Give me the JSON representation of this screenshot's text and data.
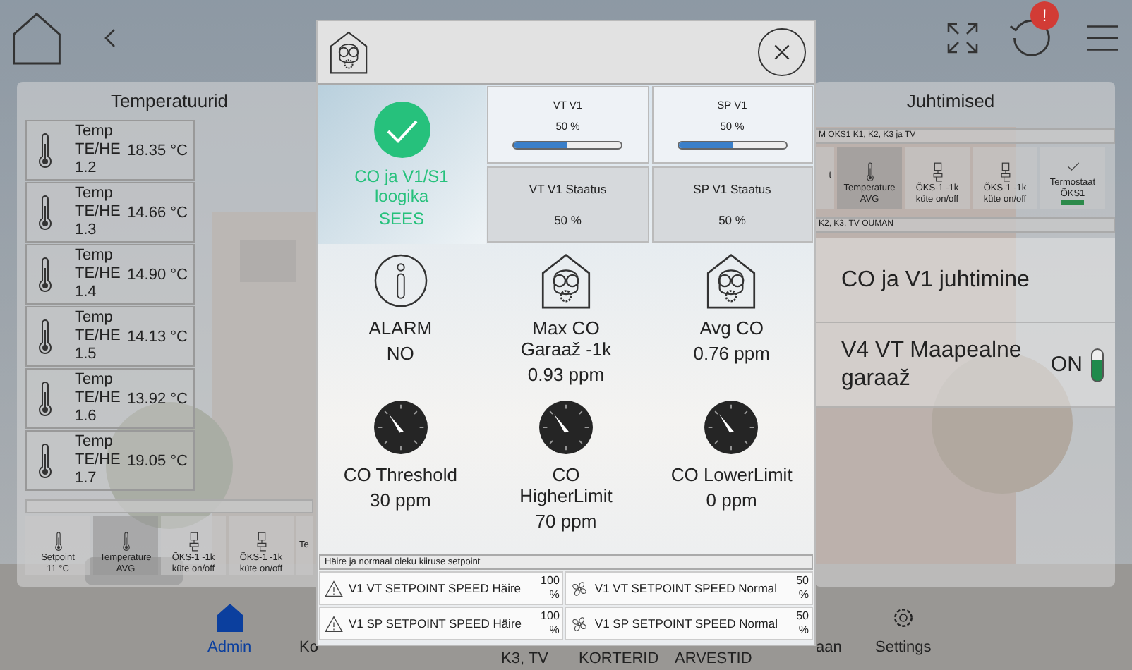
{
  "header": {
    "badge": "!"
  },
  "temperatures": {
    "title": "Temperatuurid",
    "sensors": [
      {
        "label": "Temp TE/HE 1.2",
        "value": "18.35 °C"
      },
      {
        "label": "Temp TE/HE 1.3",
        "value": "14.66 °C"
      },
      {
        "label": "Temp TE/HE 1.4",
        "value": "14.90 °C"
      },
      {
        "label": "Temp TE/HE 1.5",
        "value": "14.13 °C"
      },
      {
        "label": "Temp TE/HE 1.6",
        "value": "13.92 °C"
      },
      {
        "label": "Temp TE/HE 1.7",
        "value": "19.05 °C"
      }
    ],
    "tiles": [
      {
        "kind": "thermometer",
        "name": "Setpoint",
        "value": "11 °C",
        "highlighted": false
      },
      {
        "kind": "thermometer",
        "name": "Temperature AVG",
        "highlighted": true
      },
      {
        "kind": "valve",
        "name": "ÕKS-1 -1k küte on/off",
        "highlighted": false
      },
      {
        "kind": "valve",
        "name": "ÕKS-1 -1k küte on/off",
        "highlighted": false
      },
      {
        "kind": "text",
        "name": "Te",
        "highlighted": false
      }
    ]
  },
  "controls": {
    "title": "Juhtimised",
    "group": "M ÕKS1 K1, K2, K3 ja TV",
    "tiles": [
      {
        "kind": "text",
        "name": "t",
        "highlighted": false
      },
      {
        "kind": "thermometer",
        "name": "Temperature AVG",
        "highlighted": true
      },
      {
        "kind": "valve",
        "name": "ÕKS-1 -1k küte on/off",
        "highlighted": false
      },
      {
        "kind": "valve",
        "name": "ÕKS-1 -1k küte on/off",
        "highlighted": false
      },
      {
        "kind": "check",
        "name": "Termostaat ÕKS1",
        "highlighted": false
      }
    ],
    "group2": "K2, K3, TV OUMAN",
    "rows": [
      {
        "kind": "link",
        "label": "CO ja V1 juhtimine"
      },
      {
        "kind": "switch",
        "label": "V4 VT Maapealne garaaž",
        "state": "ON",
        "on": true
      }
    ]
  },
  "nav": [
    {
      "kind": "home",
      "label": "Admin",
      "selected": true
    },
    {
      "kind": "text",
      "label": "Ko",
      "selected": false
    },
    {
      "kind": "low",
      "label": "K3, TV",
      "selected": false
    },
    {
      "kind": "low",
      "label": "KORTERID",
      "selected": false
    },
    {
      "kind": "low",
      "label": "ARVESTID",
      "selected": false
    },
    {
      "kind": "text",
      "label": "aan",
      "selected": false
    },
    {
      "kind": "gear",
      "label": "Settings",
      "selected": false
    }
  ],
  "modal": {
    "status": {
      "label": "CO ja V1/S1 loogika",
      "value": "SEES",
      "ok": true
    },
    "setpoints": [
      {
        "label": "VT V1",
        "value": "50 %",
        "level": 0.5
      },
      {
        "label": "SP V1",
        "value": "50 %",
        "level": 0.5
      }
    ],
    "statuses": [
      {
        "label": "VT V1 Staatus",
        "value": "50 %"
      },
      {
        "label": "SP V1 Staatus",
        "value": "50 %"
      }
    ],
    "readings": [
      {
        "kind": "info",
        "label": "ALARM",
        "value": "NO"
      },
      {
        "kind": "mask",
        "label": "Max CO Garaaž -1k",
        "value": "0.93 ppm"
      },
      {
        "kind": "mask",
        "label": "Avg CO",
        "value": "0.76 ppm"
      },
      {
        "kind": "gauge",
        "label": "CO Threshold",
        "value": "30 ppm"
      },
      {
        "kind": "gauge",
        "label": "CO HigherLimit",
        "value": "70 ppm"
      },
      {
        "kind": "gauge",
        "label": "CO LowerLimit",
        "value": "0 ppm"
      }
    ],
    "speed_group": "Häire ja normaal oleku kiiruse setpoint",
    "speeds": [
      {
        "kind": "warning",
        "label": "V1 VT SETPOINT SPEED Häire",
        "value": "100 %"
      },
      {
        "kind": "fan",
        "label": "V1 VT SETPOINT SPEED Normal",
        "value": "50 %"
      },
      {
        "kind": "warning",
        "label": "V1 SP SETPOINT SPEED Häire",
        "value": "100 %"
      },
      {
        "kind": "fan",
        "label": "V1 SP SETPOINT SPEED Normal",
        "value": "50 %"
      }
    ]
  }
}
